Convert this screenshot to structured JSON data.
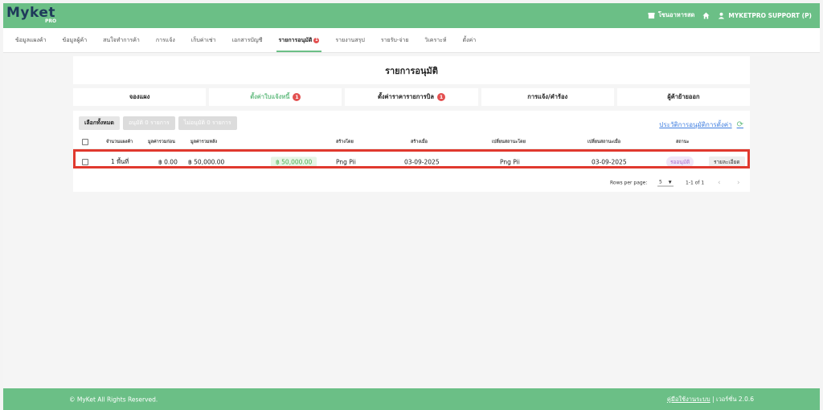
{
  "brand": {
    "name": "Myket",
    "sub": "PRO"
  },
  "topbar": {
    "market_label": "โซนอาหารสด",
    "user_label": "MYKETPRO SUPPORT (P)"
  },
  "nav": [
    {
      "label": "ข้อมูลแผงค้า",
      "active": false
    },
    {
      "label": "ข้อมูลผู้ค้า",
      "active": false
    },
    {
      "label": "สนใจทำการค้า",
      "active": false
    },
    {
      "label": "การแจ้ง",
      "active": false
    },
    {
      "label": "เก็บค่าเช่า",
      "active": false
    },
    {
      "label": "เอกสารบัญชี",
      "active": false
    },
    {
      "label": "รายการอนุมัติ",
      "active": true,
      "badge": "1"
    },
    {
      "label": "รายงานสรุป",
      "active": false
    },
    {
      "label": "รายรับ-จ่าย",
      "active": false
    },
    {
      "label": "วิเคราะห์",
      "active": false
    },
    {
      "label": "ตั้งค่า",
      "active": false
    }
  ],
  "page_title": "รายการอนุมัติ",
  "tabs": [
    {
      "label": "จองแผง",
      "active": false,
      "badge": ""
    },
    {
      "label": "ตั้งค่าใบแจ้งหนี้",
      "active": true,
      "badge": "1"
    },
    {
      "label": "ตั้งค่าราคารายการบิล",
      "active": false,
      "badge": "1"
    },
    {
      "label": "การแจ้ง/คำร้อง",
      "active": false,
      "badge": ""
    },
    {
      "label": "ผู้ค้าย้ายออก",
      "active": false,
      "badge": ""
    }
  ],
  "actions": {
    "select_all": "เลือกทั้งหมด",
    "approve": "อนุมัติ 0 รายการ",
    "reject": "ไม่อนุมัติ 0 รายการ"
  },
  "history_link": "ประวัติการอนุมัติการตั้งค่า",
  "table": {
    "headers": [
      "จำนวนแผงค้า",
      "มูลค่ารวมก่อน",
      "มูลค่ารวมหลัง",
      "สร้างโดย",
      "สร้างเมื่อ",
      "เปลี่ยนสถานะโดย",
      "เปลี่ยนสถานะเมื่อ",
      "สถานะ"
    ],
    "rows": [
      {
        "stalls": "1 พื้นที่",
        "before": "฿ 0.00",
        "after": "฿ 50,000.00",
        "amount": "฿ 50,000.00",
        "created_by": "Png Pii",
        "created_at": "03-09-2025",
        "changed_by": "Png Pii",
        "changed_at": "03-09-2025",
        "status": "รออนุมัติ",
        "detail": "รายละเอียด"
      }
    ]
  },
  "pager": {
    "rows_label": "Rows per page:",
    "rows_value": "5",
    "range": "1-1 of 1"
  },
  "footer": {
    "copyright": "© MyKet All Rights Reserved.",
    "manual": "คู่มือใช้งานระบบ",
    "version": "เวอร์ชั่น 2.0.6"
  },
  "colors": {
    "primary": "#6bbf86",
    "badge": "#e35050",
    "highlight": "#e0392e",
    "link": "#3d7de0"
  }
}
